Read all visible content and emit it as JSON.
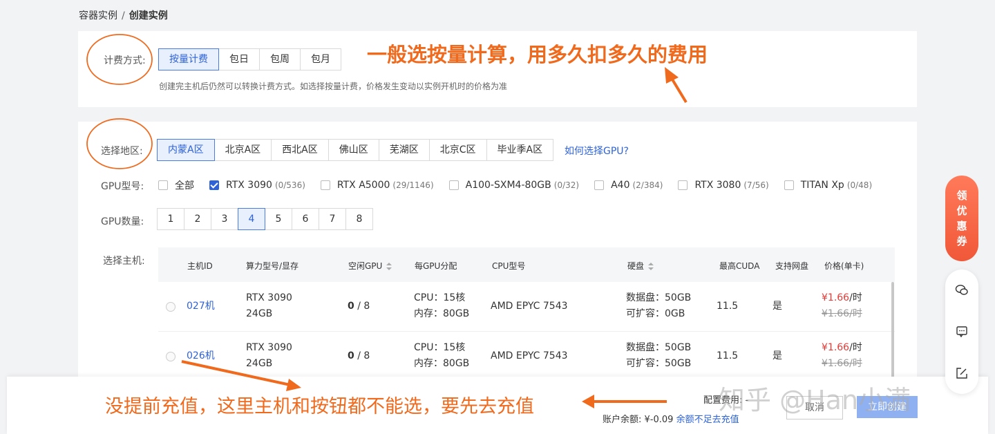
{
  "breadcrumb": {
    "parent": "容器实例",
    "separator": "/",
    "current": "创建实例"
  },
  "billing": {
    "label": "计费方式:",
    "options": [
      "按量计费",
      "包日",
      "包周",
      "包月"
    ],
    "active_index": 0,
    "hint": "创建完主机后仍然可以转换计费方式。如选择按量计费，价格发生变动以实例开机时的价格为准"
  },
  "region": {
    "label": "选择地区:",
    "options": [
      "内蒙A区",
      "北京A区",
      "西北A区",
      "佛山区",
      "芜湖区",
      "北京C区",
      "毕业季A区"
    ],
    "active_index": 0,
    "help_link": "如何选择GPU?"
  },
  "gpu_type": {
    "label": "GPU型号:",
    "items": [
      {
        "name": "全部",
        "count": "",
        "checked": false
      },
      {
        "name": "RTX 3090",
        "count": "(0/536)",
        "checked": true
      },
      {
        "name": "RTX A5000",
        "count": "(29/1146)",
        "checked": false
      },
      {
        "name": "A100-SXM4-80GB",
        "count": "(0/32)",
        "checked": false
      },
      {
        "name": "A40",
        "count": "(2/384)",
        "checked": false
      },
      {
        "name": "RTX 3080",
        "count": "(7/56)",
        "checked": false
      },
      {
        "name": "TITAN Xp",
        "count": "(0/48)",
        "checked": false
      }
    ]
  },
  "gpu_count": {
    "label": "GPU数量:",
    "options": [
      "1",
      "2",
      "3",
      "4",
      "5",
      "6",
      "7",
      "8"
    ],
    "active_index": 3
  },
  "host_table": {
    "label": "选择主机:",
    "columns": [
      "主机ID",
      "算力型号/显存",
      "空闲GPU",
      "每GPU分配",
      "CPU型号",
      "硬盘",
      "最高CUDA",
      "支持网盘",
      "价格(单卡)"
    ],
    "rows": [
      {
        "id": "027机",
        "model": "RTX 3090",
        "vram": "24GB",
        "free": "0",
        "total": "/ 8",
        "cpu": "CPU：15核",
        "mem": "内存：80GB",
        "cpu_model": "AMD EPYC 7543",
        "disk": "数据盘：50GB",
        "expand": "可扩容：0GB",
        "cuda": "11.5",
        "netdisk": "是",
        "price": "¥1.66",
        "unit": "/时",
        "old_price": "¥1.66/时"
      },
      {
        "id": "026机",
        "model": "RTX 3090",
        "vram": "24GB",
        "free": "0",
        "total": "/ 8",
        "cpu": "CPU：15核",
        "mem": "内存：80GB",
        "cpu_model": "AMD EPYC 7543",
        "disk": "数据盘：50GB",
        "expand": "可扩容：50GB",
        "cuda": "11.5",
        "netdisk": "是",
        "price": "¥1.66",
        "unit": "/时",
        "old_price": "¥1.66/时"
      }
    ]
  },
  "footer": {
    "fee_label": "配置费用:",
    "fee_value": "-",
    "balance_label": "账户余额:",
    "balance_value": "¥-0.09",
    "recharge_link": "余额不足去充值",
    "cancel_label": "取消",
    "create_label": "立即创建"
  },
  "sidebar": {
    "promo": [
      "领",
      "优",
      "惠",
      "券"
    ]
  },
  "annotations": {
    "top": "一般选按量计算，用多久扣多久的费用",
    "bottom": "没提前充值，这里主机和按钮都不能选，要先去充值"
  },
  "watermark": "知乎 @Han小满",
  "colors": {
    "accent": "#2d62d8",
    "annotation": "#f06a1e",
    "price": "#e53935"
  }
}
